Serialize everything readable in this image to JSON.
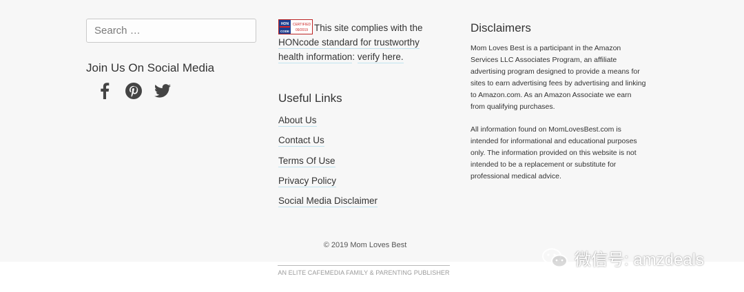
{
  "search": {
    "placeholder": "Search …"
  },
  "social": {
    "title": "Join Us On Social Media",
    "icons": [
      "facebook-icon",
      "pinterest-icon",
      "twitter-icon"
    ]
  },
  "hon": {
    "badge_top": "HON",
    "badge_mid": "CODE",
    "badge_certified": "CERTIFIED",
    "badge_date": "09/2019",
    "text_before": "This site complies with the ",
    "link_standard": "HONcode standard for trustworthy health information",
    "text_after": ": ",
    "link_verify": "verify here."
  },
  "useful_links": {
    "title": "Useful Links",
    "items": [
      "About Us",
      "Contact Us",
      "Terms Of Use",
      "Privacy Policy",
      "Social Media Disclaimer"
    ]
  },
  "disclaimers": {
    "title": "Disclaimers",
    "p1": "Mom Loves Best is a participant in the Amazon Services LLC Associates Program, an affiliate advertising program designed to provide a means for sites to earn advertising fees by advertising and linking to Amazon.com. As an Amazon Associate we earn from qualifying purchases.",
    "p2": "All information found on MomLovesBest.com is intended for informational and educational purposes only. The information provided on this website is not intended to be a replacement or substitute for professional medical advice."
  },
  "copyright": "© 2019 Mom Loves Best",
  "publisher": "AN ELITE CAFEMEDIA FAMILY & PARENTING PUBLISHER",
  "watermark": {
    "text": "微信号: amzdeals",
    "icon": "wechat-icon"
  },
  "colors": {
    "footer_bg": "#f7f7f7",
    "link_underline": "#bfe3f0"
  }
}
